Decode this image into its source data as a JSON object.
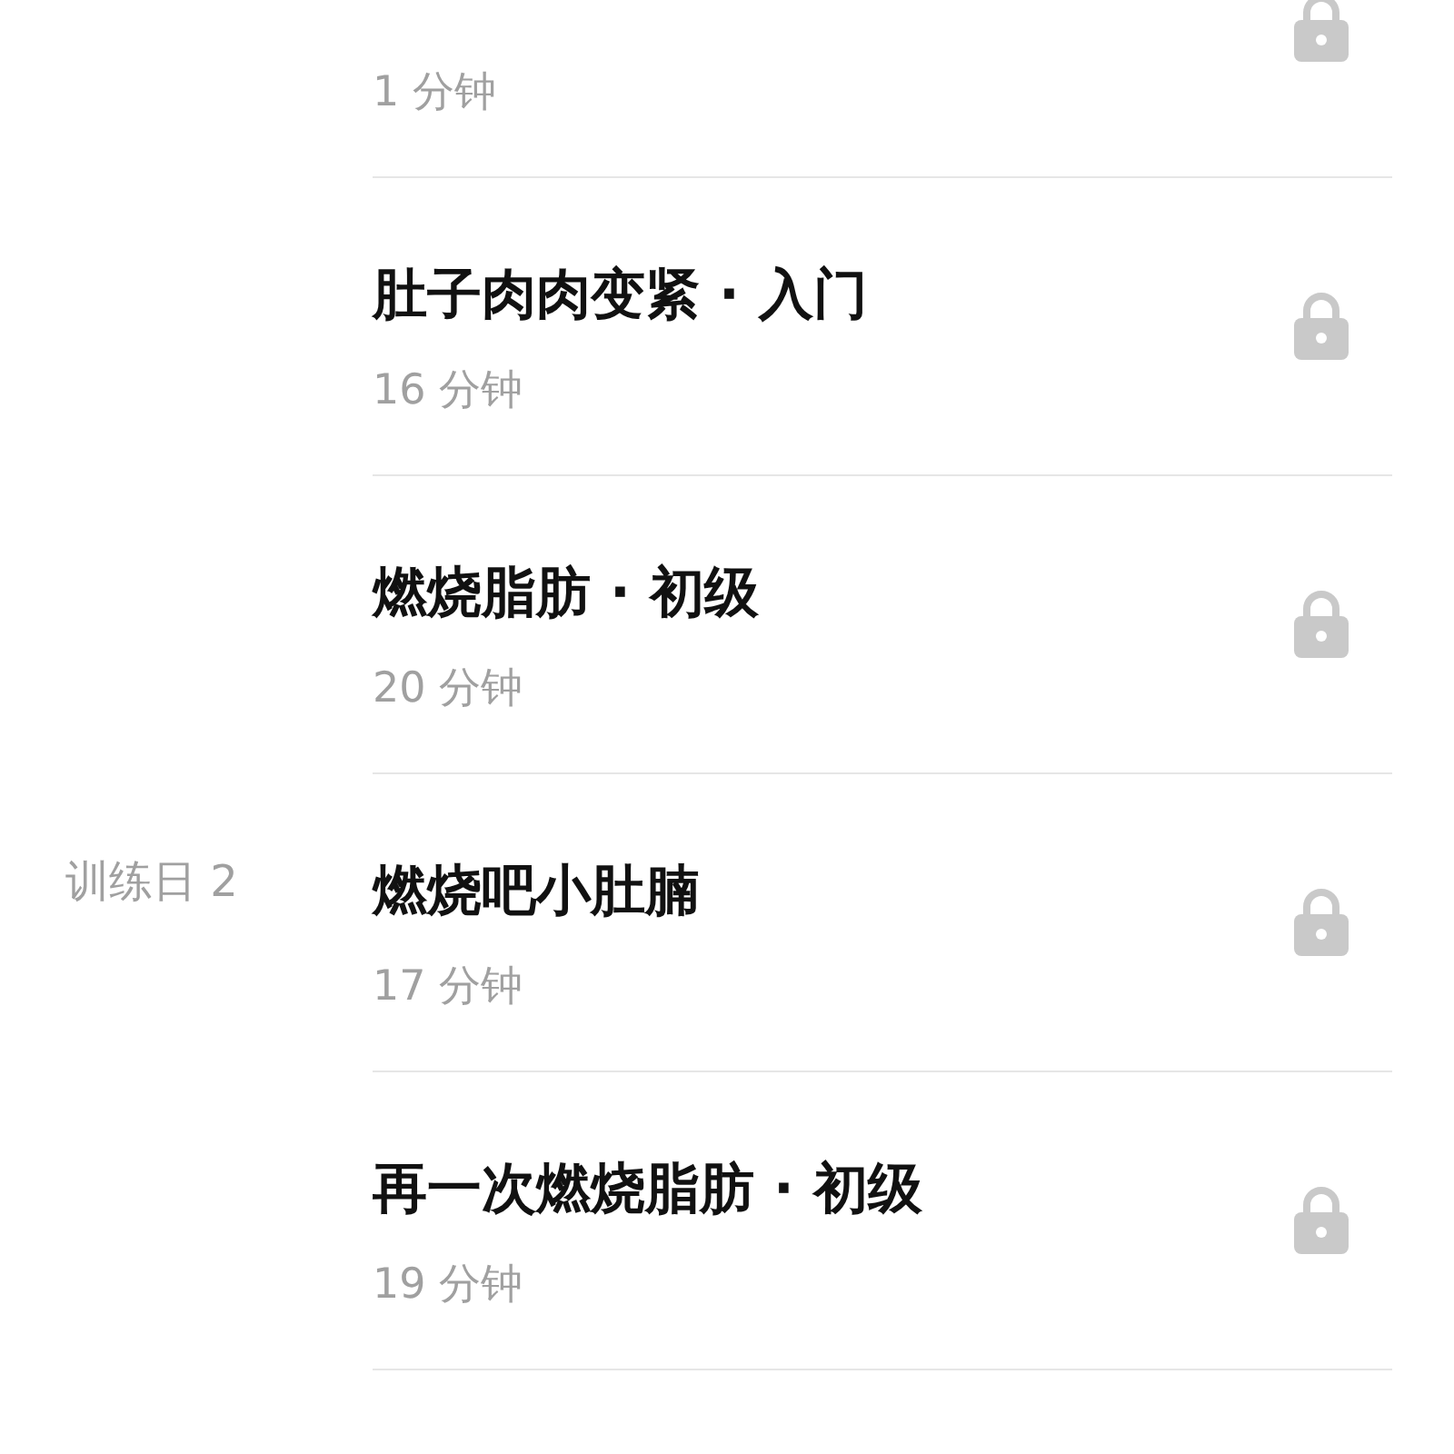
{
  "lessons": [
    {
      "duration": "1 分钟",
      "locked": true
    },
    {
      "title": "肚子肉肉变紧 · 入门",
      "duration": "16 分钟",
      "locked": true
    },
    {
      "title": "燃烧脂肪 · 初级",
      "duration": "20 分钟",
      "locked": true
    },
    {
      "day": "训练日 2",
      "title": "燃烧吧小肚腩",
      "duration": "17 分钟",
      "locked": true
    },
    {
      "title": "再一次燃烧脂肪 · 初级",
      "duration": "19 分钟",
      "locked": true
    }
  ]
}
